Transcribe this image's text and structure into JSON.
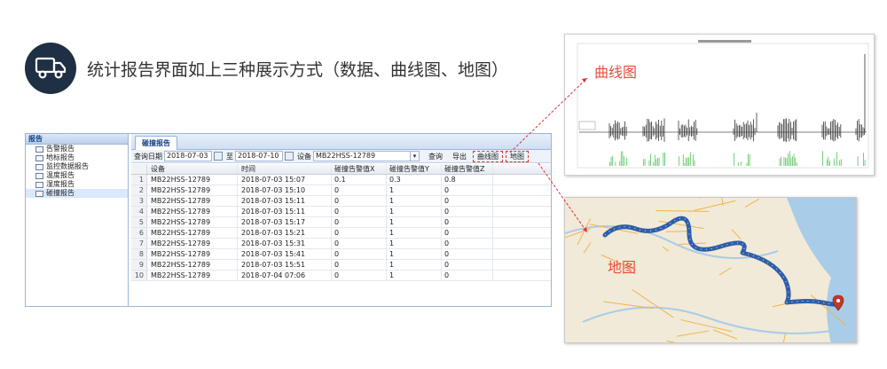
{
  "headline": "统计报告界面如上三种展示方式（数据、曲线图、地图）",
  "sidebar": {
    "header": "报告",
    "items": [
      {
        "label": "告警报告"
      },
      {
        "label": "地标报告"
      },
      {
        "label": "监控数据报告"
      },
      {
        "label": "温度报告"
      },
      {
        "label": "湿度报告"
      },
      {
        "label": "碰撞报告",
        "selected": true
      }
    ]
  },
  "tab": {
    "label": "碰撞报告"
  },
  "toolbar": {
    "query_date_label": "查询日期",
    "start_date": "2018-07-03",
    "to_label": "至",
    "end_date": "2018-07-10",
    "device_label": "设备",
    "device_value": "MB22HSS-12789",
    "query_button": "查询",
    "export_button": "导出",
    "curve_button": "曲线图",
    "map_button": "地图"
  },
  "table": {
    "columns": [
      "设备",
      "时间",
      "碰撞告警值X",
      "碰撞告警值Y",
      "碰撞告警值Z"
    ],
    "rows": [
      {
        "n": "1",
        "device": "MB22HSS-12789",
        "time": "2018-07-03 15:07",
        "x": "0.1",
        "y": "0.3",
        "z": "0.8"
      },
      {
        "n": "2",
        "device": "MB22HSS-12789",
        "time": "2018-07-03 15:10",
        "x": "0",
        "y": "1",
        "z": "0"
      },
      {
        "n": "3",
        "device": "MB22HSS-12789",
        "time": "2018-07-03 15:11",
        "x": "0",
        "y": "1",
        "z": "0"
      },
      {
        "n": "4",
        "device": "MB22HSS-12789",
        "time": "2018-07-03 15:11",
        "x": "0",
        "y": "1",
        "z": "0"
      },
      {
        "n": "5",
        "device": "MB22HSS-12789",
        "time": "2018-07-03 15:17",
        "x": "0",
        "y": "1",
        "z": "0"
      },
      {
        "n": "6",
        "device": "MB22HSS-12789",
        "time": "2018-07-03 15:21",
        "x": "0",
        "y": "1",
        "z": "0"
      },
      {
        "n": "7",
        "device": "MB22HSS-12789",
        "time": "2018-07-03 15:31",
        "x": "0",
        "y": "1",
        "z": "0"
      },
      {
        "n": "8",
        "device": "MB22HSS-12789",
        "time": "2018-07-03 15:41",
        "x": "0",
        "y": "1",
        "z": "0"
      },
      {
        "n": "9",
        "device": "MB22HSS-12789",
        "time": "2018-07-03 15:51",
        "x": "0",
        "y": "1",
        "z": "0"
      },
      {
        "n": "10",
        "device": "MB22HSS-12789",
        "time": "2018-07-04 07:06",
        "x": "0",
        "y": "1",
        "z": "0"
      }
    ]
  },
  "chart_panel": {
    "label": "曲线图"
  },
  "map_panel": {
    "label": "地图"
  },
  "colors": {
    "accent_red": "#e74c3c",
    "truck_circle": "#1f2f44",
    "route_blue": "#2f5ea8",
    "series_dark": "#333333",
    "series_green": "#55c35a"
  },
  "icons": [
    "truck-icon",
    "document-icon",
    "calendar-icon",
    "chevron-down-icon",
    "location-pin-icon"
  ]
}
